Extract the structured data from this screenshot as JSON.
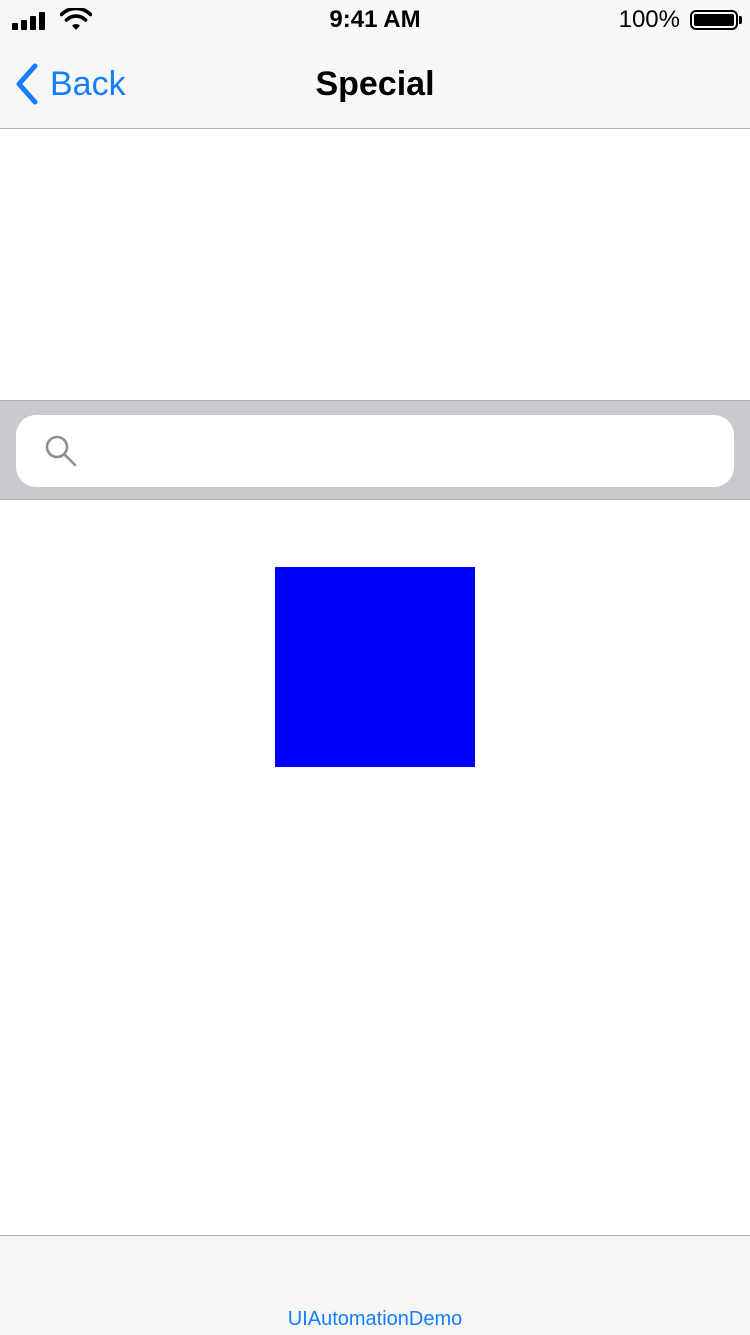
{
  "status_bar": {
    "time": "9:41 AM",
    "battery_percent": "100%",
    "signal_icon": "cellular-signal-icon",
    "wifi_icon": "wifi-icon",
    "battery_icon": "battery-full-icon"
  },
  "nav": {
    "back_label": "Back",
    "back_icon": "chevron-left-icon",
    "title": "Special"
  },
  "search": {
    "icon": "search-icon",
    "value": "",
    "placeholder": ""
  },
  "content": {
    "square_color": "#0000ff"
  },
  "footer": {
    "label": "UIAutomationDemo"
  },
  "colors": {
    "accent": "#157efb",
    "bar_background": "#f7f7f7",
    "search_bar_background": "#c9c9ce"
  }
}
